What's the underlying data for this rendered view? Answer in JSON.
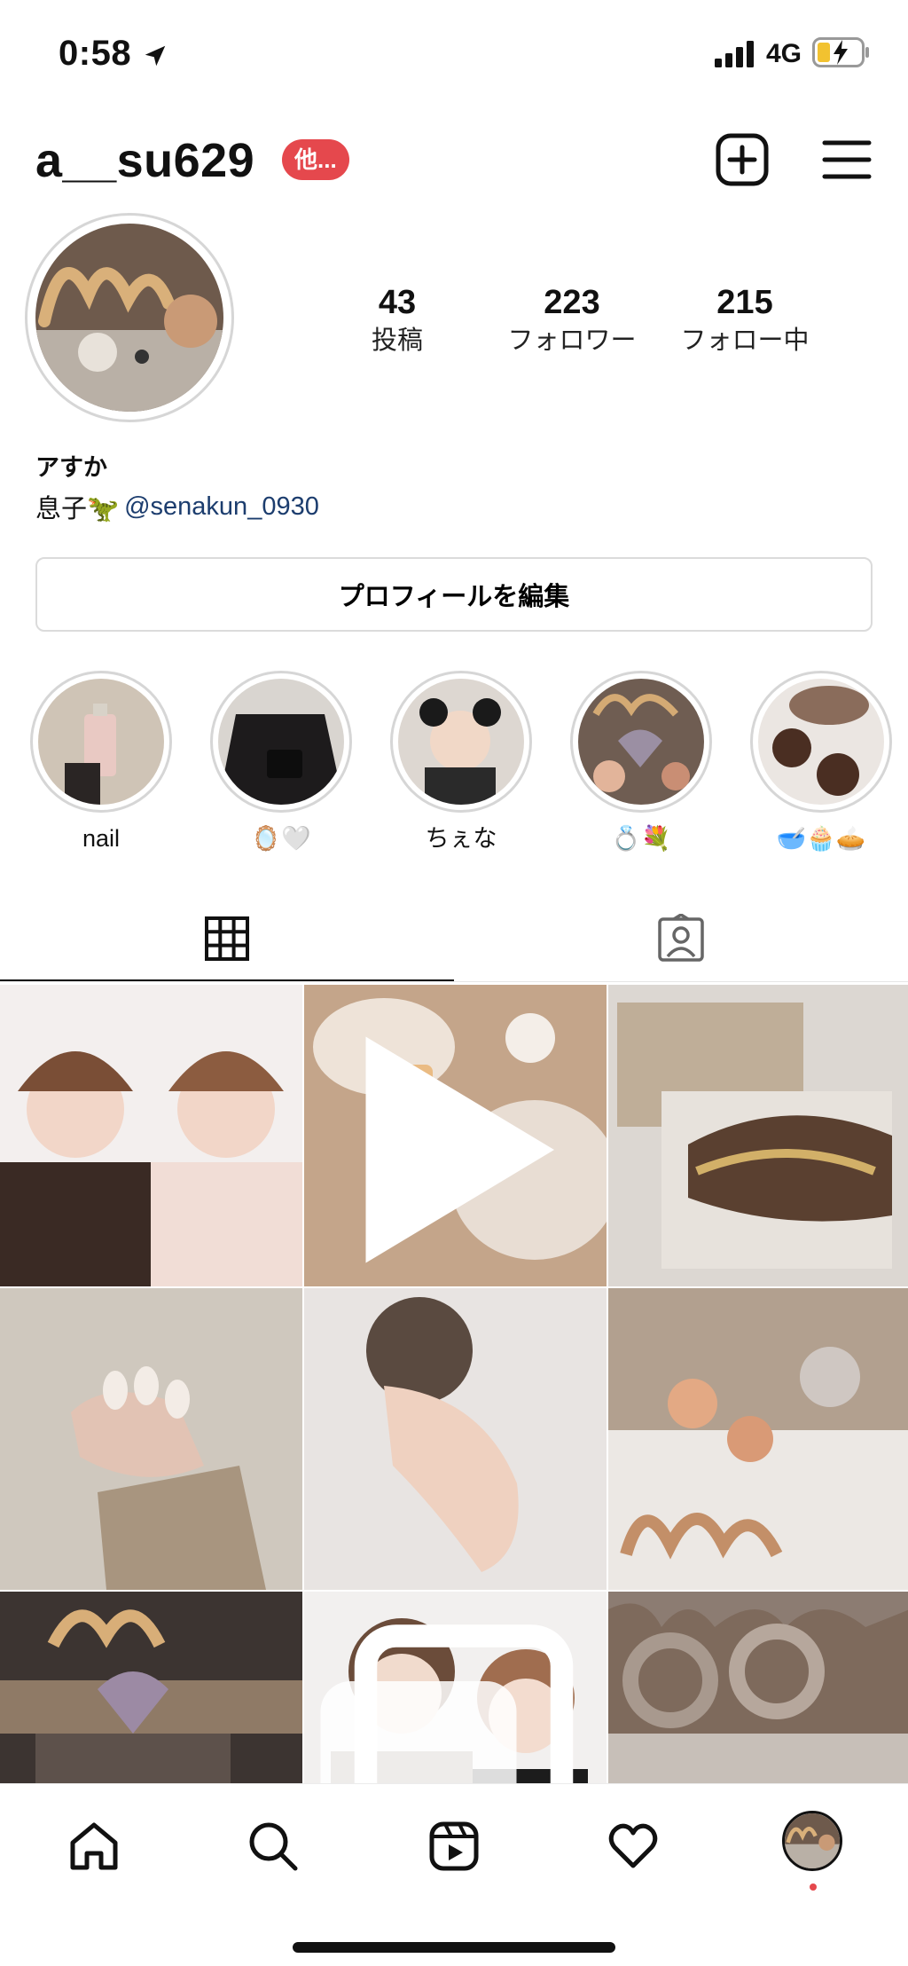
{
  "status_bar": {
    "time": "0:58",
    "network": "4G"
  },
  "header": {
    "username": "a__su629",
    "badge": "他..."
  },
  "profile": {
    "stats": [
      {
        "value": "43",
        "label": "投稿"
      },
      {
        "value": "223",
        "label": "フォロワー"
      },
      {
        "value": "215",
        "label": "フォロー中"
      }
    ],
    "display_name": "アすか",
    "bio_prefix": "息子🦖",
    "bio_mention": "@senakun_0930",
    "edit_button": "プロフィールを編集"
  },
  "highlights": [
    {
      "label": "nail"
    },
    {
      "label": "🪞🤍"
    },
    {
      "label": "ちぇな"
    },
    {
      "label": "💍💐"
    },
    {
      "label": "🥣🧁🥧"
    }
  ],
  "tabs": [
    {
      "name": "grid",
      "active": true
    },
    {
      "name": "tagged",
      "active": false
    }
  ],
  "colors": {
    "badge": "#e5484d",
    "mention": "#1c3d6e",
    "activity_dot": "#e5484d"
  }
}
